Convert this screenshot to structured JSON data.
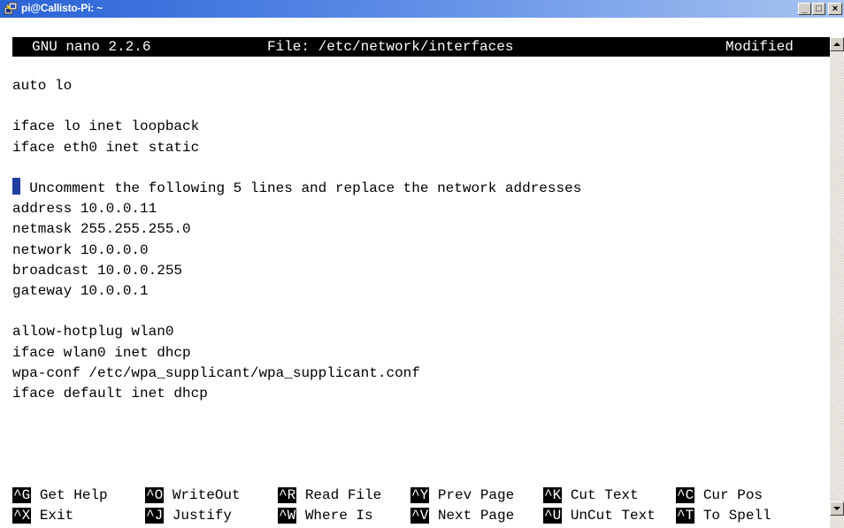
{
  "window": {
    "title": "pi@Callisto-Pi: ~",
    "controls": {
      "minimize": "_",
      "maximize": "□",
      "close": "×"
    }
  },
  "nano": {
    "version": "GNU nano 2.2.6",
    "file_label": "File: /etc/network/interfaces",
    "status": "Modified"
  },
  "lines": [
    "auto lo",
    "",
    "iface lo inet loopback",
    "iface eth0 inet static",
    "",
    "# Uncomment the following 5 lines and replace the network addresses",
    "address 10.0.0.11",
    "netmask 255.255.255.0",
    "network 10.0.0.0",
    "broadcast 10.0.0.255",
    "gateway 10.0.0.1",
    "",
    "allow-hotplug wlan0",
    "iface wlan0 inet dhcp",
    "wpa-conf /etc/wpa_supplicant/wpa_supplicant.conf",
    "iface default inet dhcp"
  ],
  "shortcuts": {
    "row1": [
      {
        "key": "^G",
        "label": "Get Help"
      },
      {
        "key": "^O",
        "label": "WriteOut"
      },
      {
        "key": "^R",
        "label": "Read File"
      },
      {
        "key": "^Y",
        "label": "Prev Page"
      },
      {
        "key": "^K",
        "label": "Cut Text"
      },
      {
        "key": "^C",
        "label": "Cur Pos"
      }
    ],
    "row2": [
      {
        "key": "^X",
        "label": "Exit"
      },
      {
        "key": "^J",
        "label": "Justify"
      },
      {
        "key": "^W",
        "label": "Where Is"
      },
      {
        "key": "^V",
        "label": "Next Page"
      },
      {
        "key": "^U",
        "label": "UnCut Text"
      },
      {
        "key": "^T",
        "label": "To Spell"
      }
    ]
  },
  "colors": {
    "titlebar": "#2a63d6",
    "cursor": "#1f3fa0",
    "terminal_bg": "#ffffff",
    "terminal_fg": "#000000"
  }
}
